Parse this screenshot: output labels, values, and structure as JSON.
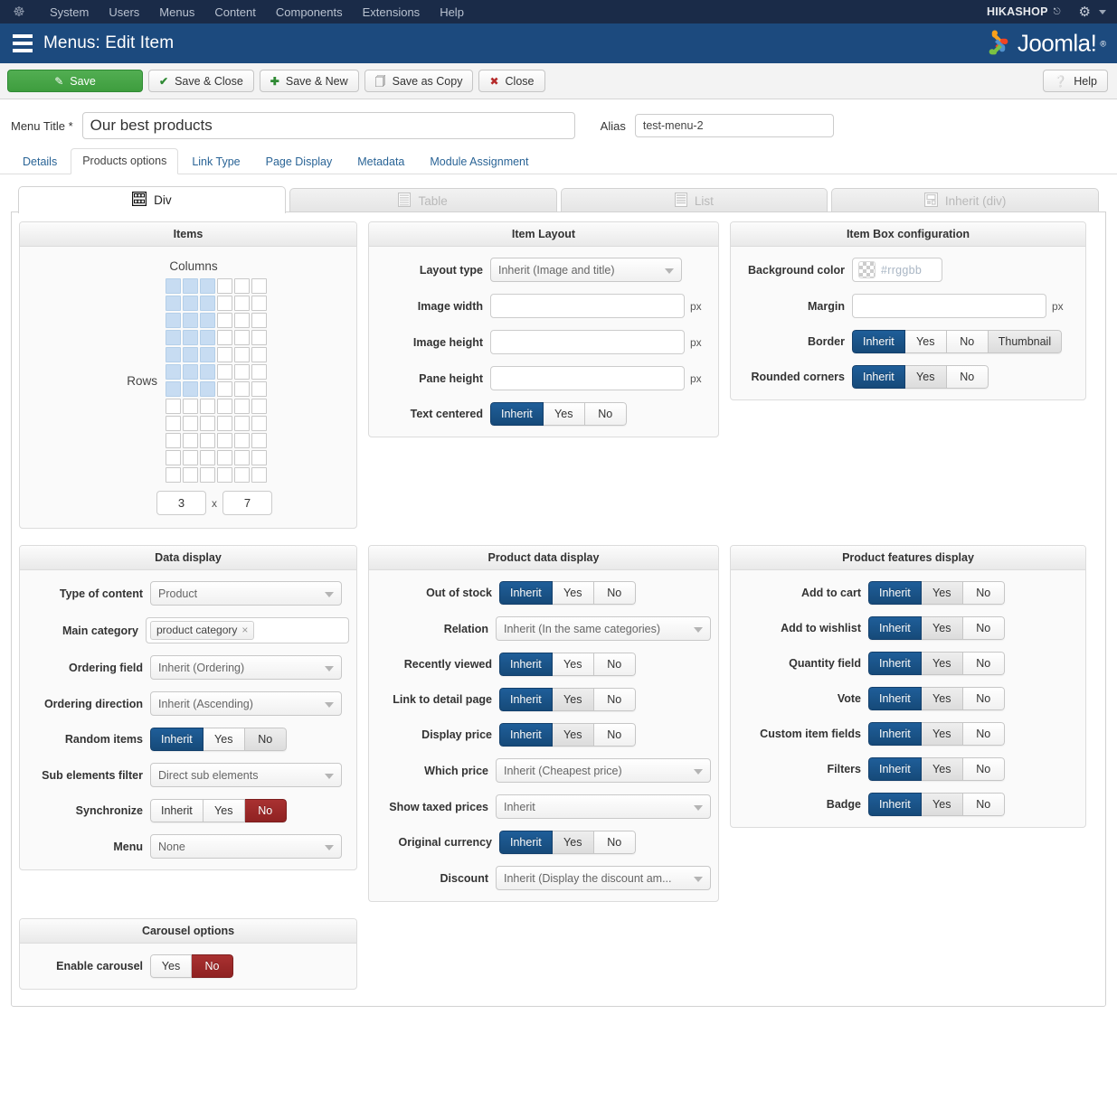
{
  "adminbar": {
    "logo_icon": "joomla-logo-icon",
    "menu": [
      "System",
      "Users",
      "Menus",
      "Content",
      "Components",
      "Extensions",
      "Help"
    ],
    "right_label": "HIKASHOP",
    "external_icon": "external-link-icon",
    "gear_icon": "gear-icon",
    "caret_icon": "chevron-down-icon"
  },
  "header": {
    "icon": "menu-list-icon",
    "title": "Menus: Edit Item",
    "brand": "Joomla!",
    "brand_reg": "®"
  },
  "toolbar": {
    "save": "Save",
    "save_close": "Save & Close",
    "save_new": "Save & New",
    "save_copy": "Save as Copy",
    "close": "Close",
    "help": "Help",
    "icons": {
      "save": "edit-pencil-icon",
      "save_close": "check-icon",
      "save_new": "plus-icon",
      "save_copy": "copy-icon",
      "close": "close-circle-icon",
      "help": "help-circle-icon"
    }
  },
  "title_row": {
    "menu_title_label": "Menu Title *",
    "menu_title_value": "Our best products",
    "menu_title_placeholder": "",
    "alias_label": "Alias",
    "alias_value": "test-menu-2",
    "alias_placeholder": ""
  },
  "main_tabs": [
    {
      "label": "Details",
      "active": false
    },
    {
      "label": "Products options",
      "active": true
    },
    {
      "label": "Link Type",
      "active": false
    },
    {
      "label": "Page Display",
      "active": false
    },
    {
      "label": "Metadata",
      "active": false
    },
    {
      "label": "Module Assignment",
      "active": false
    }
  ],
  "sub_tabs": [
    {
      "label": "Div",
      "icon": "grid-blocks-icon",
      "active": true
    },
    {
      "label": "Table",
      "icon": "table-icon",
      "active": false
    },
    {
      "label": "List",
      "icon": "list-icon",
      "active": false
    },
    {
      "label": "Inherit (div)",
      "icon": "inherit-icon",
      "active": false
    }
  ],
  "items_panel": {
    "title": "Items",
    "columns_label": "Columns",
    "rows_label": "Rows",
    "grid_cols": 6,
    "grid_rows": 12,
    "selected_cols": 3,
    "selected_rows": 7,
    "cols_value": "3",
    "separator": "x",
    "rows_value": "7"
  },
  "item_layout_panel": {
    "title": "Item Layout",
    "fields": {
      "layout_type_label": "Layout type",
      "layout_type_value": "Inherit (Image and title)",
      "image_width_label": "Image width",
      "image_width_value": "",
      "image_width_unit": "px",
      "image_height_label": "Image height",
      "image_height_value": "",
      "image_height_unit": "px",
      "pane_height_label": "Pane height",
      "pane_height_value": "",
      "pane_height_unit": "px",
      "text_centered_label": "Text centered",
      "text_centered_options": [
        "Inherit",
        "Yes",
        "No"
      ],
      "text_centered_selected": "Inherit"
    }
  },
  "item_box_panel": {
    "title": "Item Box configuration",
    "fields": {
      "background_color_label": "Background color",
      "background_color_placeholder": "#rrggbb",
      "background_color_value": "",
      "margin_label": "Margin",
      "margin_value": "",
      "margin_unit": "px",
      "border_label": "Border",
      "border_options": [
        "Inherit",
        "Yes",
        "No",
        "Thumbnail"
      ],
      "border_selected": "Inherit",
      "border_highlighted": "Thumbnail",
      "rounded_label": "Rounded corners",
      "rounded_options": [
        "Inherit",
        "Yes",
        "No"
      ],
      "rounded_selected": "Inherit"
    }
  },
  "data_display_panel": {
    "title": "Data display",
    "fields": {
      "type_of_content_label": "Type of content",
      "type_of_content_value": "Product",
      "main_category_label": "Main category",
      "main_category_chip": "product category",
      "main_category_chip_remove": "×",
      "ordering_field_label": "Ordering field",
      "ordering_field_value": "Inherit (Ordering)",
      "ordering_direction_label": "Ordering direction",
      "ordering_direction_value": "Inherit (Ascending)",
      "random_items_label": "Random items",
      "random_items_options": [
        "Inherit",
        "Yes",
        "No"
      ],
      "random_items_selected": "Inherit",
      "random_items_highlighted": "No",
      "sub_elements_label": "Sub elements filter",
      "sub_elements_value": "Direct sub elements",
      "synchronize_label": "Synchronize",
      "synchronize_options": [
        "Inherit",
        "Yes",
        "No"
      ],
      "synchronize_selected": "No",
      "menu_label": "Menu",
      "menu_value": "None"
    }
  },
  "product_data_panel": {
    "title": "Product data display",
    "rows": [
      {
        "label": "Out of stock",
        "type": "buttons",
        "options": [
          "Inherit",
          "Yes",
          "No"
        ],
        "selected": "Inherit"
      },
      {
        "label": "Relation",
        "type": "select",
        "value": "Inherit (In the same categories)"
      },
      {
        "label": "Recently viewed",
        "type": "buttons",
        "options": [
          "Inherit",
          "Yes",
          "No"
        ],
        "selected": "Inherit"
      },
      {
        "label": "Link to detail page",
        "type": "buttons",
        "options": [
          "Inherit",
          "Yes",
          "No"
        ],
        "selected": "Inherit",
        "highlighted": "Yes"
      },
      {
        "label": "Display price",
        "type": "buttons",
        "options": [
          "Inherit",
          "Yes",
          "No"
        ],
        "selected": "Inherit",
        "highlighted": "Yes"
      },
      {
        "label": "Which price",
        "type": "select",
        "value": "Inherit (Cheapest price)"
      },
      {
        "label": "Show taxed prices",
        "type": "select",
        "value": "Inherit"
      },
      {
        "label": "Original currency",
        "type": "buttons",
        "options": [
          "Inherit",
          "Yes",
          "No"
        ],
        "selected": "Inherit",
        "highlighted": "Yes"
      },
      {
        "label": "Discount",
        "type": "select",
        "value": "Inherit (Display the discount am..."
      }
    ]
  },
  "product_features_panel": {
    "title": "Product features display",
    "rows": [
      {
        "label": "Add to cart",
        "options": [
          "Inherit",
          "Yes",
          "No"
        ],
        "selected": "Inherit",
        "highlighted": "Yes"
      },
      {
        "label": "Add to wishlist",
        "options": [
          "Inherit",
          "Yes",
          "No"
        ],
        "selected": "Inherit",
        "highlighted": "Yes"
      },
      {
        "label": "Quantity field",
        "options": [
          "Inherit",
          "Yes",
          "No"
        ],
        "selected": "Inherit",
        "highlighted": "Yes"
      },
      {
        "label": "Vote",
        "options": [
          "Inherit",
          "Yes",
          "No"
        ],
        "selected": "Inherit",
        "highlighted": "Yes"
      },
      {
        "label": "Custom item fields",
        "options": [
          "Inherit",
          "Yes",
          "No"
        ],
        "selected": "Inherit",
        "highlighted": "Yes"
      },
      {
        "label": "Filters",
        "options": [
          "Inherit",
          "Yes",
          "No"
        ],
        "selected": "Inherit",
        "highlighted": "Yes"
      },
      {
        "label": "Badge",
        "options": [
          "Inherit",
          "Yes",
          "No"
        ],
        "selected": "Inherit",
        "highlighted": "Yes"
      }
    ]
  },
  "carousel_panel": {
    "title": "Carousel options",
    "enable_label": "Enable carousel",
    "enable_options": [
      "Yes",
      "No"
    ],
    "enable_selected": "No"
  },
  "colors": {
    "adminbar_bg": "#1a2b48",
    "header_bg": "#1c4a7e",
    "save_green": "#3e9d3e",
    "active_blue": "#164a79",
    "selected_red": "#8f2222",
    "grid_selected": "#c7dcf2",
    "link_blue": "#2a6496"
  }
}
